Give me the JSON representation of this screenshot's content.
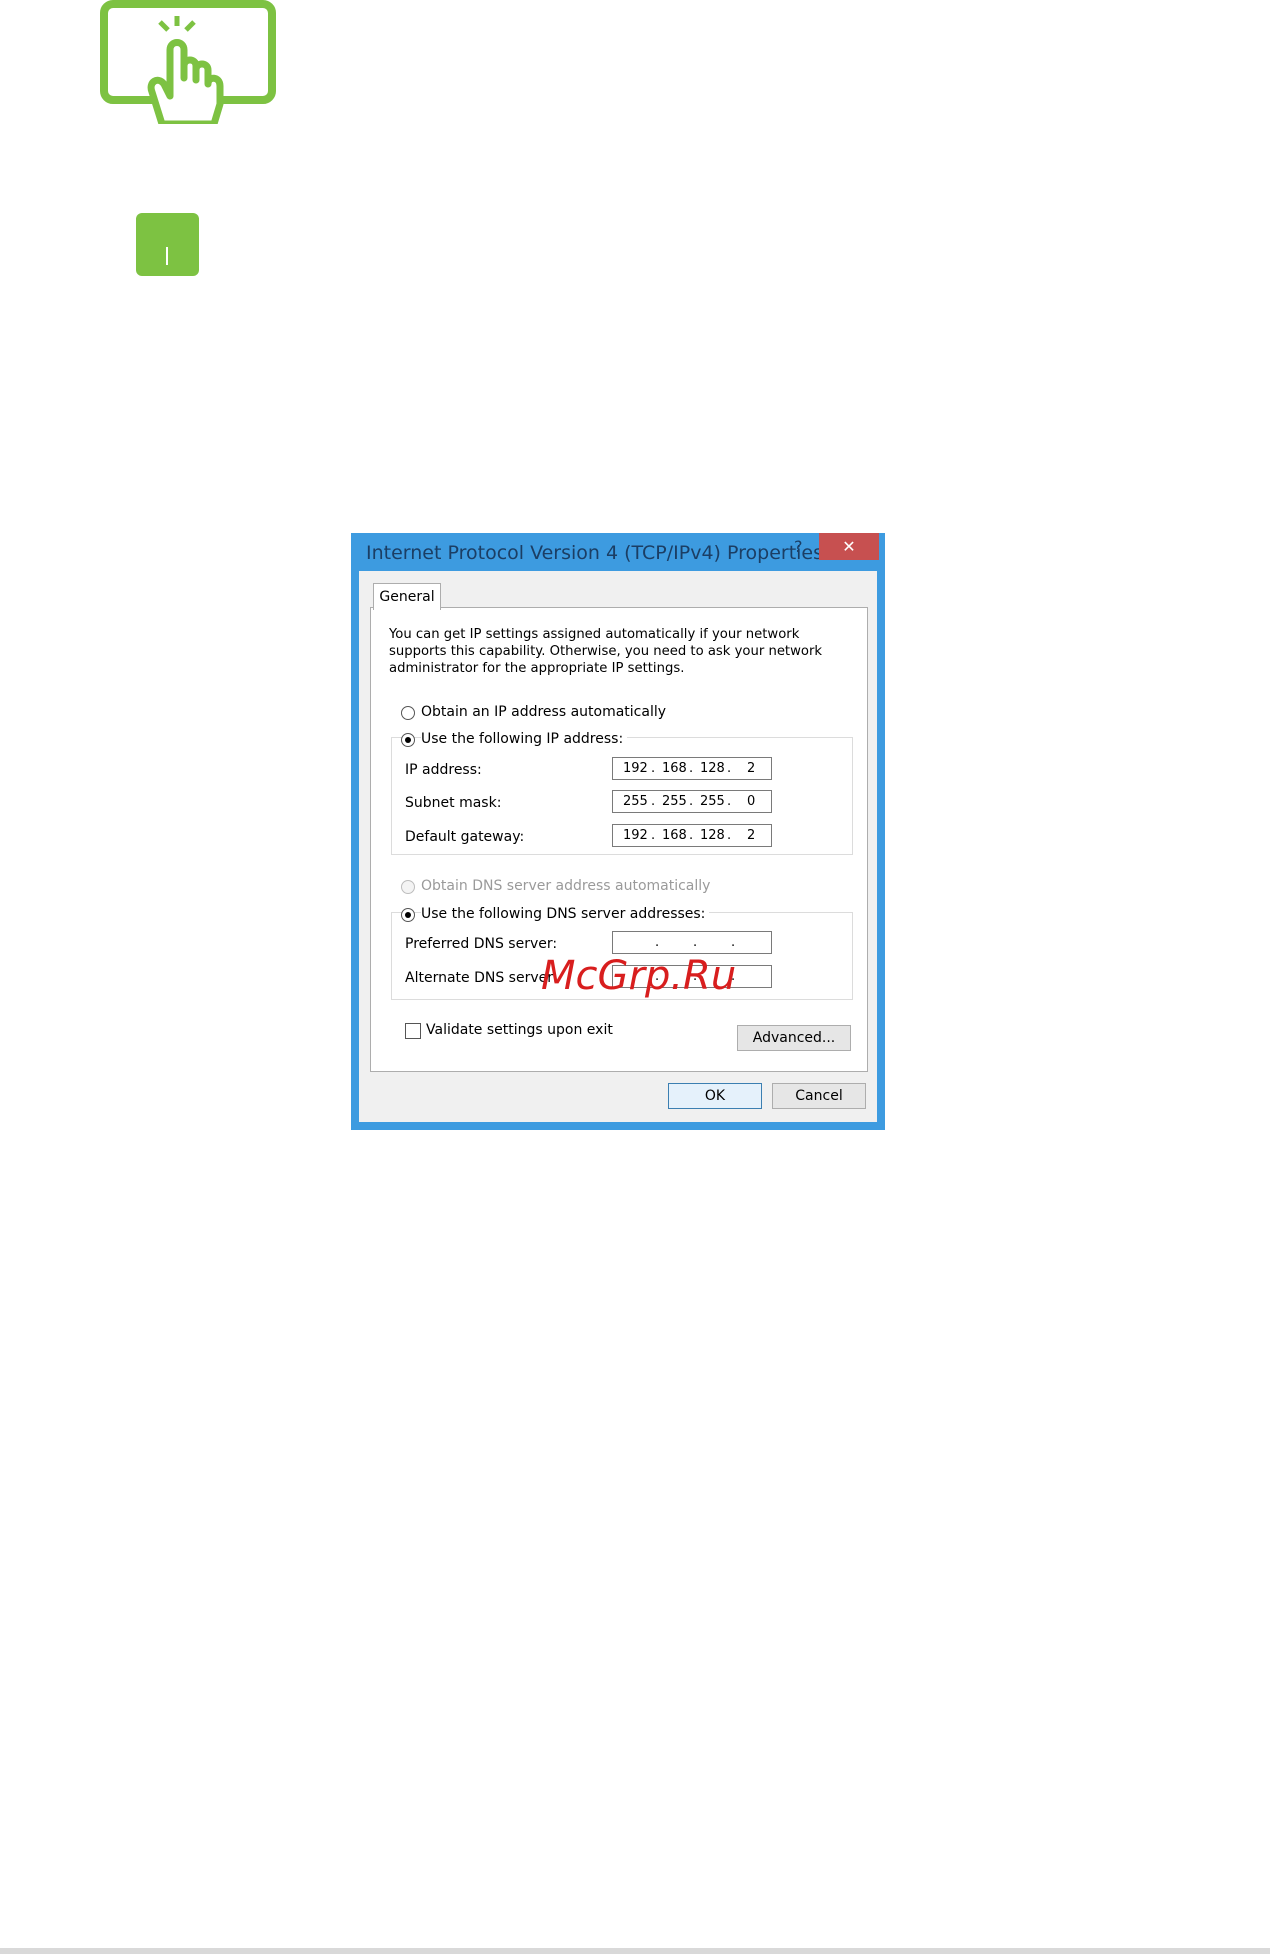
{
  "dialog": {
    "title": "Internet Protocol Version 4 (TCP/IPv4) Properties",
    "help": "?",
    "close": "✕",
    "tab_general": "General",
    "description": "You can get IP settings assigned automatically if your network supports this capability. Otherwise, you need to ask your network administrator for the appropriate IP settings.",
    "ip_auto_label": "Obtain an IP address automatically",
    "ip_manual_label": "Use the following IP address:",
    "ip_address_label": "IP address:",
    "subnet_mask_label": "Subnet mask:",
    "default_gateway_label": "Default gateway:",
    "ip_address": [
      "192",
      "168",
      "128",
      "2"
    ],
    "subnet_mask": [
      "255",
      "255",
      "255",
      "0"
    ],
    "default_gateway": [
      "192",
      "168",
      "128",
      "2"
    ],
    "dns_auto_label": "Obtain DNS server address automatically",
    "dns_manual_label": "Use the following DNS server addresses:",
    "preferred_dns_label": "Preferred DNS server:",
    "alternate_dns_label": "Alternate DNS server:",
    "validate_label": "Validate settings upon exit",
    "advanced_button": "Advanced...",
    "ok_button": "OK",
    "cancel_button": "Cancel",
    "selected_ip_option": "manual",
    "selected_dns_option": "manual",
    "validate_checked": false
  },
  "watermark": "McGrp.Ru",
  "colors": {
    "accent_green": "#7dc242",
    "dialog_frame": "#3d9be0",
    "close_button": "#c75050",
    "watermark": "#d81e1e"
  },
  "icons": [
    "touch-screen-icon",
    "green-square-icon"
  ]
}
